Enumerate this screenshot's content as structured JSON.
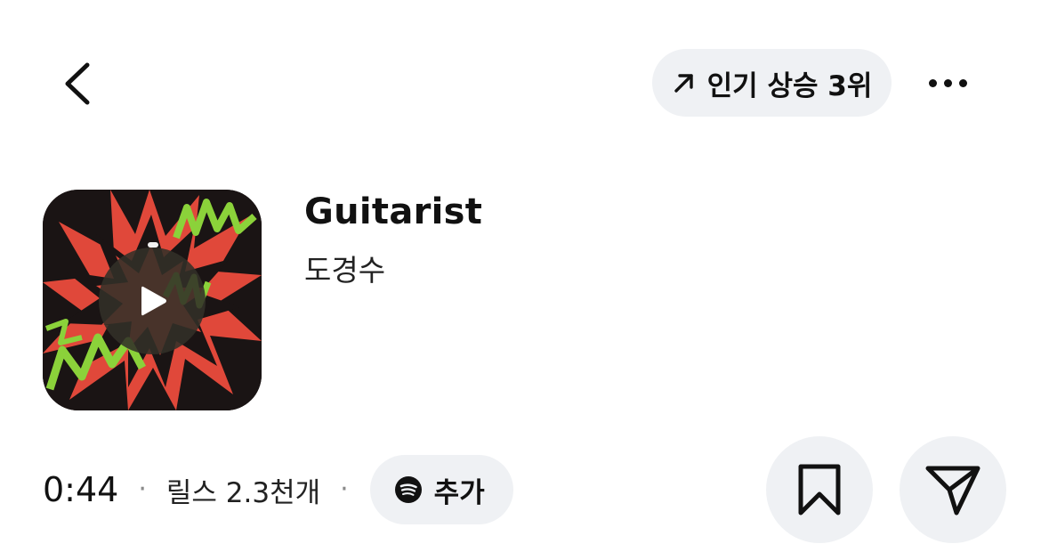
{
  "header": {
    "back_icon": "chevron-left-icon",
    "trend_icon": "arrow-up-right-icon",
    "trend_label": "인기 상승 3위",
    "more_icon": "more-horizontal-icon"
  },
  "track": {
    "title": "Guitarist",
    "artist": "도경수",
    "cover_icon": "album-cover",
    "play_icon": "play-icon"
  },
  "meta": {
    "duration": "0:44",
    "separator": "·",
    "reels_count": "릴스 2.3천개",
    "spotify_icon": "spotify-icon",
    "spotify_label": "추가"
  },
  "actions": {
    "save_icon": "bookmark-icon",
    "share_icon": "send-icon"
  },
  "colors": {
    "pill_bg": "#eff1f4",
    "text": "#111111",
    "cover_red": "#e0483a",
    "cover_green": "#8bd23a",
    "cover_dark": "#1a1414"
  }
}
